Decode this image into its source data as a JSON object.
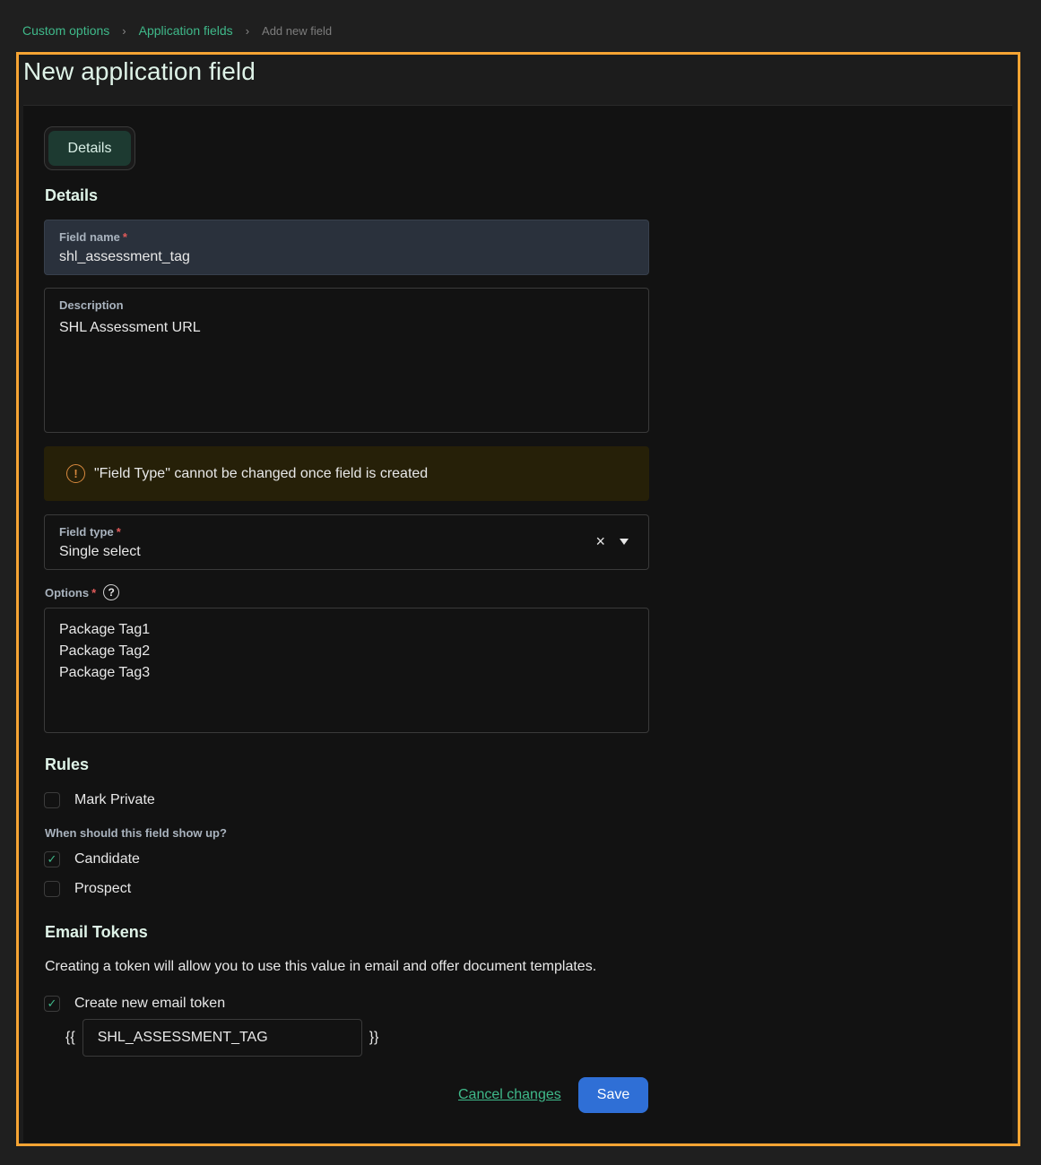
{
  "breadcrumb": {
    "items": [
      "Custom options",
      "Application fields"
    ],
    "current": "Add new field",
    "separator": "›"
  },
  "page": {
    "title": "New application field"
  },
  "tabs": [
    {
      "label": "Details",
      "active": true
    }
  ],
  "details": {
    "heading": "Details",
    "field_name": {
      "label": "Field name",
      "required": "*",
      "value": "shl_assessment_tag"
    },
    "description": {
      "label": "Description",
      "value": "SHL Assessment URL"
    },
    "alert": {
      "icon": "warning-circle-icon",
      "text": "\"Field Type\" cannot be changed once field is created"
    },
    "field_type": {
      "label": "Field type",
      "required": "*",
      "value": "Single select",
      "clear_icon": "×"
    },
    "options": {
      "label": "Options",
      "required": "*",
      "help_icon": "?",
      "values": [
        "Package Tag1",
        "Package Tag2",
        "Package Tag3"
      ]
    }
  },
  "rules": {
    "heading": "Rules",
    "mark_private": {
      "label": "Mark Private",
      "checked": false
    },
    "show_up_question": "When should this field show up?",
    "candidate": {
      "label": "Candidate",
      "checked": true
    },
    "prospect": {
      "label": "Prospect",
      "checked": false
    }
  },
  "email_tokens": {
    "heading": "Email Tokens",
    "description": "Creating a token will allow you to use this value in email and offer document templates.",
    "create_token": {
      "label": "Create new email token",
      "checked": true
    },
    "open_brace": "{{",
    "close_brace": "}}",
    "token_value": "SHL_ASSESSMENT_TAG"
  },
  "actions": {
    "cancel_label": "Cancel changes",
    "save_label": "Save"
  },
  "colors": {
    "accent": "#3fb98a",
    "primary_button": "#2f6fd6",
    "highlight_border": "#f6a433",
    "warning": "#d8893e"
  },
  "check_mark": "✓"
}
